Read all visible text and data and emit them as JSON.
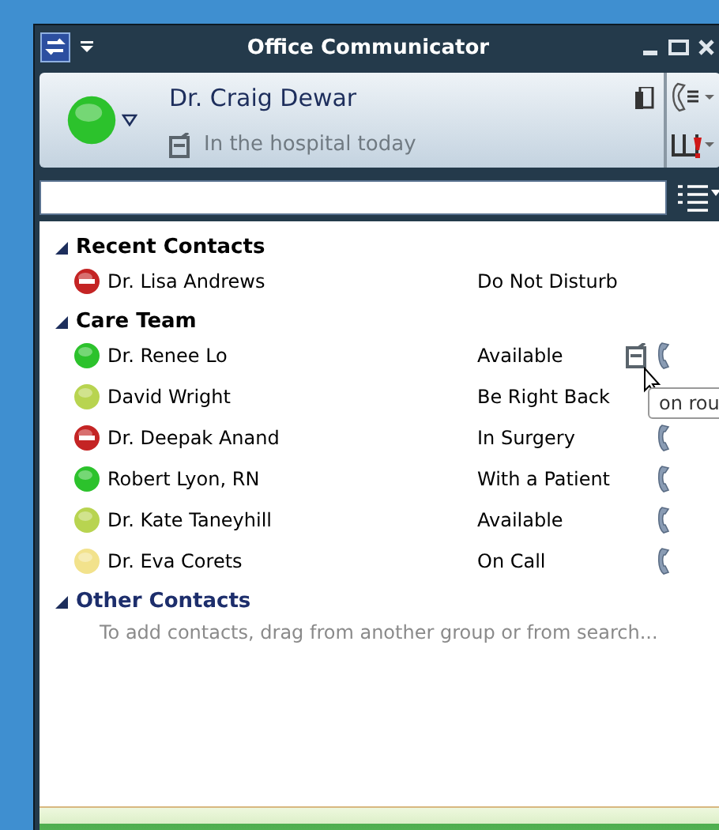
{
  "window": {
    "title": "Office Communicator"
  },
  "me": {
    "name": "Dr. Craig Dewar",
    "color": "#2cc22c",
    "kind": "normal",
    "note": "In the hospital today"
  },
  "groups": [
    {
      "name": "Recent Contacts",
      "expanded": true,
      "contacts": [
        {
          "name": "Dr. Lisa Andrews",
          "color": "#c42424",
          "kind": "dnd",
          "status": "Do Not Disturb",
          "note": false,
          "phone": false
        }
      ]
    },
    {
      "name": "Care Team",
      "expanded": true,
      "contacts": [
        {
          "name": "Dr. Renee Lo",
          "color": "#2cc22c",
          "kind": "normal",
          "status": "Available",
          "note": true,
          "phone": true
        },
        {
          "name": "David Wright",
          "color": "#b8d450",
          "kind": "normal",
          "status": "Be Right Back",
          "note": false,
          "phone": false
        },
        {
          "name": "Dr. Deepak Anand",
          "color": "#c42424",
          "kind": "dnd",
          "status": "In Surgery",
          "note": false,
          "phone": true
        },
        {
          "name": "Robert Lyon, RN",
          "color": "#2cc22c",
          "kind": "normal",
          "status": "With a Patient",
          "note": false,
          "phone": true
        },
        {
          "name": "Dr. Kate Taneyhill",
          "color": "#b8d450",
          "kind": "normal",
          "status": "Available",
          "note": false,
          "phone": true
        },
        {
          "name": "Dr. Eva Corets",
          "color": "#f2e28c",
          "kind": "normal",
          "status": "On Call",
          "note": false,
          "phone": true
        }
      ]
    },
    {
      "name": "Other Contacts",
      "expanded": true,
      "hint": "To add contacts, drag from another group or from search..."
    }
  ],
  "tooltip": {
    "text": "on rou"
  }
}
